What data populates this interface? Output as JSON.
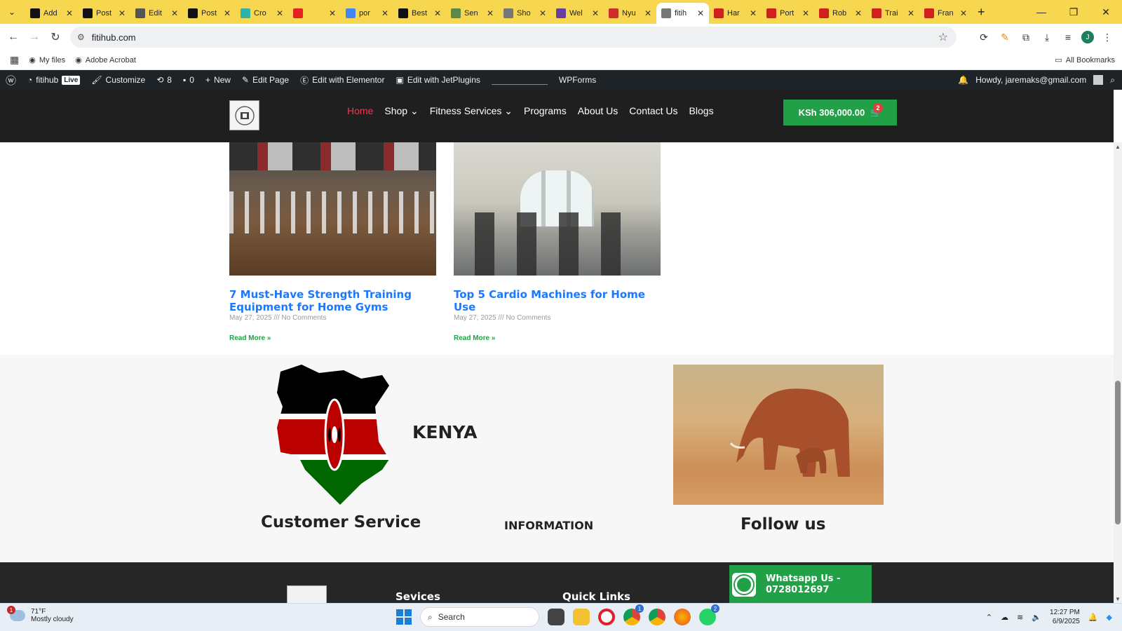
{
  "browser": {
    "tabs": [
      {
        "label": "Add",
        "color": "#111111"
      },
      {
        "label": "Post",
        "color": "#111111"
      },
      {
        "label": "Edit",
        "color": "#555555"
      },
      {
        "label": "Post",
        "color": "#111111"
      },
      {
        "label": "Cro",
        "color": "#2fb3a4"
      },
      {
        "label": "",
        "color": "#e52222"
      },
      {
        "label": "por",
        "color": "#4285f4"
      },
      {
        "label": "Best",
        "color": "#111111"
      },
      {
        "label": "Sen",
        "color": "#5a8a4a"
      },
      {
        "label": "Sho",
        "color": "#777777"
      },
      {
        "label": "Wel",
        "color": "#6b3fa0"
      },
      {
        "label": "Nyu",
        "color": "#d12b2b"
      },
      {
        "label": "fitih",
        "color": "#777777"
      },
      {
        "label": "Har",
        "color": "#d11f1f"
      },
      {
        "label": "Port",
        "color": "#d11f1f"
      },
      {
        "label": "Rob",
        "color": "#d11f1f"
      },
      {
        "label": "Trai",
        "color": "#d11f1f"
      },
      {
        "label": "Fran",
        "color": "#d11f1f"
      }
    ],
    "active_tab_index": 12,
    "url": "fitihub.com",
    "bookmarks": [
      "My files",
      "Adobe Acrobat"
    ],
    "all_bookmarks": "All Bookmarks",
    "profile_initial": "J"
  },
  "wpbar": {
    "site": "fitihub",
    "live": "Live",
    "customize": "Customize",
    "updates": "8",
    "comments": "0",
    "new": "New",
    "edit_page": "Edit Page",
    "edit_elementor": "Edit with Elementor",
    "edit_jet": "Edit with JetPlugins",
    "wpforms": "WPForms",
    "howdy": "Howdy, jaremaks@gmail.com"
  },
  "site_header": {
    "nav": [
      "Home",
      "Shop",
      "Fitness Services",
      "Programs",
      "About Us",
      "Contact Us",
      "Blogs"
    ],
    "nav_dropdown": [
      false,
      true,
      true,
      false,
      false,
      false,
      false
    ],
    "active_nav": "Home",
    "cart_total": "KSh 306,000.00",
    "cart_count": "2",
    "accent_color": "#e63b55",
    "cart_color": "#22a048"
  },
  "posts": [
    {
      "title": "7 Must-Have Strength Training Equipment for Home Gyms",
      "date": "May 27, 2025",
      "separator": "///",
      "comments": "No Comments",
      "read_more": "Read More »"
    },
    {
      "title": "Top 5 Cardio Machines for Home Use",
      "date": "May 27, 2025",
      "separator": "///",
      "comments": "No Comments",
      "read_more": "Read More »"
    }
  ],
  "kenya_section": {
    "word": "KENYA",
    "customer_service": "Customer Service",
    "information": "INFORMATION",
    "follow_us": "Follow us"
  },
  "footer": {
    "col1": "Sevices",
    "col2": "Quick Links",
    "whatsapp_line1": "Whatsapp Us -",
    "whatsapp_line2": "0728012697"
  },
  "taskbar": {
    "temp": "71°F",
    "weather": "Mostly cloudy",
    "weather_badge": "1",
    "search": "Search",
    "time": "12:27 PM",
    "date": "6/9/2025",
    "chrome_badge": "1",
    "whatsapp_badge": "2"
  }
}
